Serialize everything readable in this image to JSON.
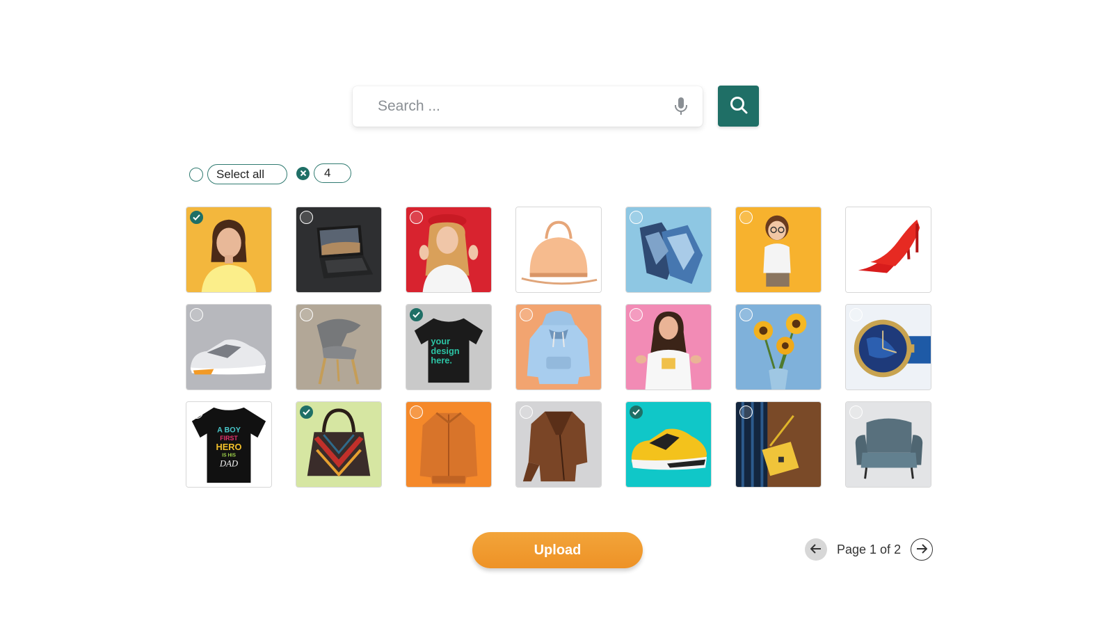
{
  "search": {
    "placeholder": "Search ...",
    "value": ""
  },
  "icons": {
    "mic": "microphone-icon",
    "search": "search-icon",
    "prev": "arrow-left-icon",
    "next": "arrow-right-icon"
  },
  "selection": {
    "select_all_label": "Select all",
    "selected_count": "4"
  },
  "colors": {
    "accent": "#1f6f66",
    "upload": "#f0992e"
  },
  "items": [
    {
      "name": "Woman in yellow top",
      "selected": true
    },
    {
      "name": "Laptop",
      "selected": false
    },
    {
      "name": "Woman in red beret",
      "selected": false
    },
    {
      "name": "Peach handbag",
      "selected": false
    },
    {
      "name": "Blue gloves",
      "selected": false
    },
    {
      "name": "Girl with glasses",
      "selected": false
    },
    {
      "name": "Red high heels",
      "selected": false
    },
    {
      "name": "Grey sneaker",
      "selected": false
    },
    {
      "name": "Modern chair",
      "selected": false
    },
    {
      "name": "Black t-shirt mockup",
      "selected": true
    },
    {
      "name": "Blue hoodie",
      "selected": false
    },
    {
      "name": "Woman in white t-shirt",
      "selected": false
    },
    {
      "name": "Sunflowers in vase",
      "selected": false
    },
    {
      "name": "Wrist watch",
      "selected": false
    },
    {
      "name": "Printed black t-shirt",
      "selected": false
    },
    {
      "name": "Patterned handbag",
      "selected": true
    },
    {
      "name": "Orange jacket",
      "selected": false
    },
    {
      "name": "Brown leather jacket",
      "selected": false
    },
    {
      "name": "Yellow sneaker",
      "selected": true
    },
    {
      "name": "Yellow shoulder bag",
      "selected": false
    },
    {
      "name": "Grey armchair",
      "selected": false
    }
  ],
  "tshirt_print": {
    "line1": "A BOY",
    "line2": "FIRST",
    "line3": "HERO",
    "line4": "IS HIS",
    "line5": "DAD"
  },
  "mockup_print": {
    "line1": "your",
    "line2": "design",
    "line3": "here."
  },
  "upload_label": "Upload",
  "pagination": {
    "label": "Page 1 of 2",
    "current": 1,
    "total": 2
  }
}
